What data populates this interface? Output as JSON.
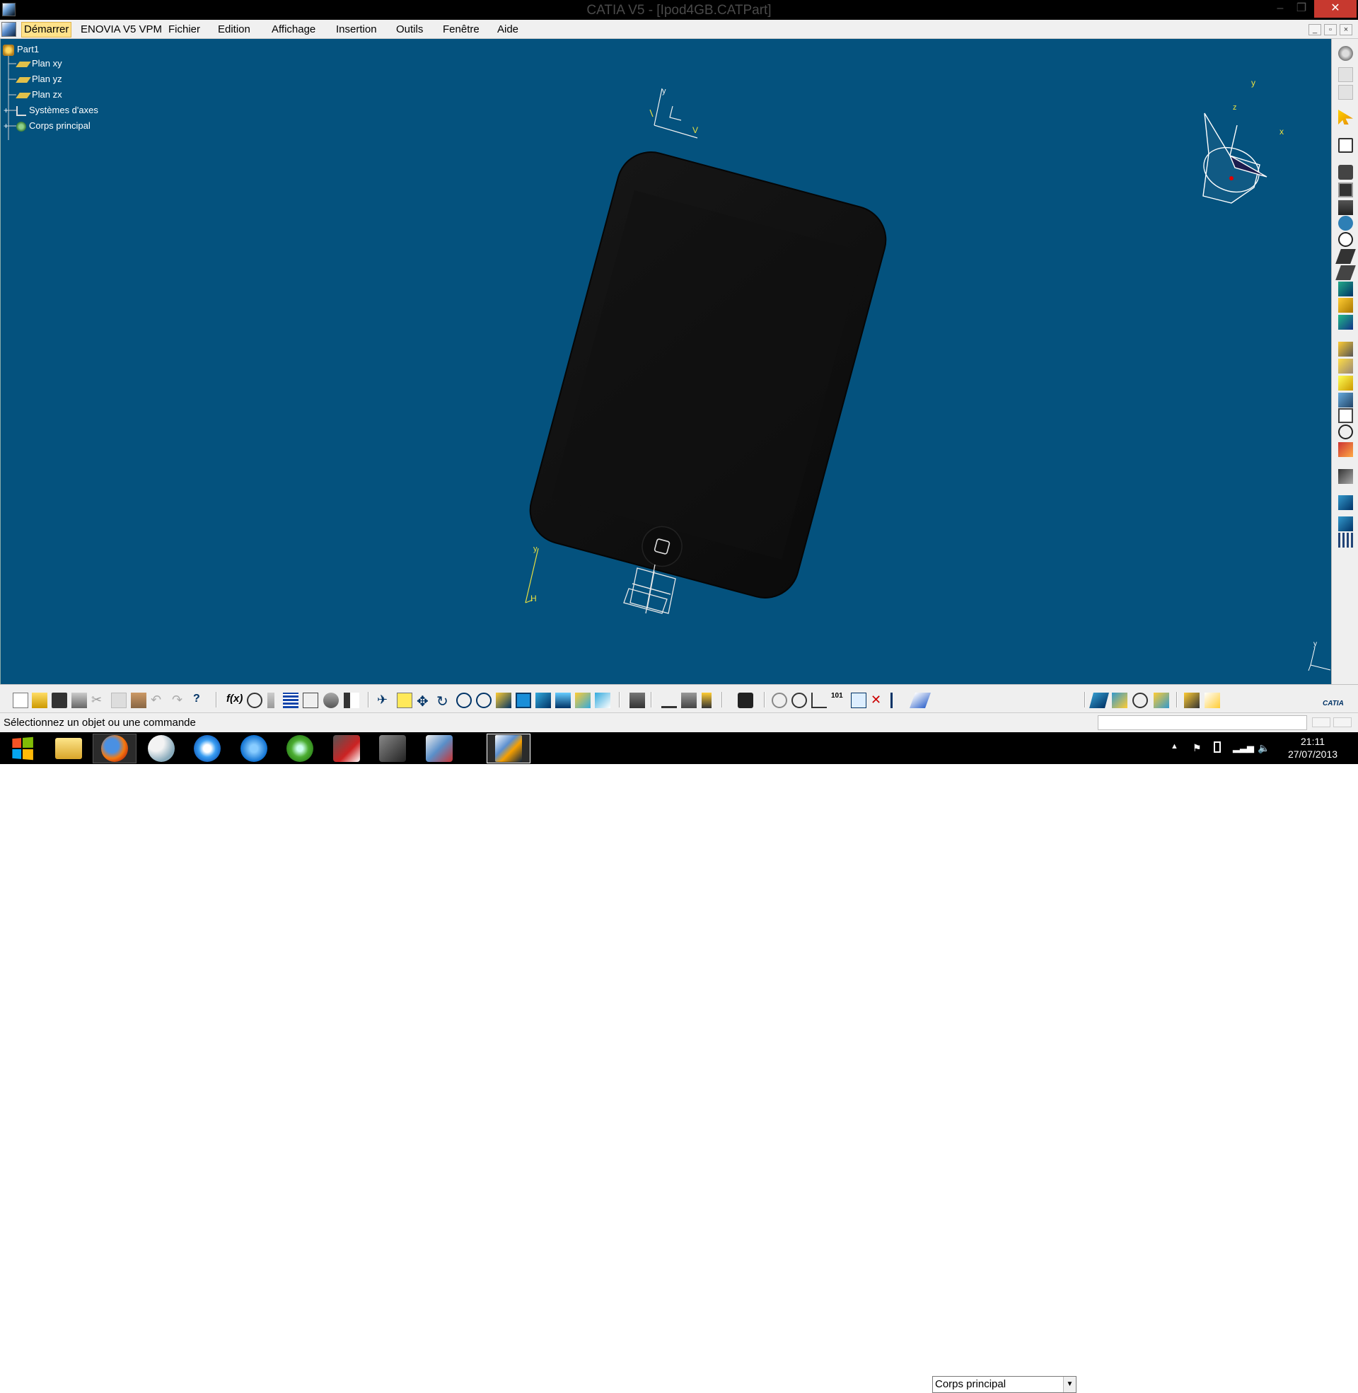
{
  "window": {
    "title": "CATIA V5 - [Ipod4GB.CATPart]",
    "minimize": "–",
    "maximize": "❐",
    "close": "✕"
  },
  "menu": {
    "items": [
      {
        "label": "Démarrer"
      },
      {
        "label": "ENOVIA V5 VPM"
      },
      {
        "label": "Fichier"
      },
      {
        "label": "Edition"
      },
      {
        "label": "Affichage"
      },
      {
        "label": "Insertion"
      },
      {
        "label": "Outils"
      },
      {
        "label": "Fenêtre"
      },
      {
        "label": "Aide"
      }
    ],
    "active": "Démarrer"
  },
  "tree": {
    "root": "Part1",
    "items": [
      {
        "label": "Plan xy",
        "icon": "plane-icon"
      },
      {
        "label": "Plan yz",
        "icon": "plane-icon"
      },
      {
        "label": "Plan zx",
        "icon": "plane-icon"
      },
      {
        "label": "Systèmes d'axes",
        "icon": "axis-system-icon"
      },
      {
        "label": "Corps principal",
        "icon": "part-body-icon"
      }
    ]
  },
  "viewport": {
    "background": "#04527e",
    "axis_labels": {
      "x": "x",
      "y": "y",
      "z": "z",
      "v": "V",
      "h": "H"
    }
  },
  "toolbar": {
    "current_body": "Corps principal"
  },
  "status": {
    "message": "Sélectionnez un objet ou une commande",
    "command_input": ""
  },
  "taskbar": {
    "apps": [
      "start-icon",
      "file-explorer-icon",
      "firefox-icon",
      "paint-icon",
      "itunes-icon",
      "thunder-icon",
      "utorrent-icon",
      "movie-maker-icon",
      "graphics-app-icon",
      "solidworks-icon",
      "catia-icon"
    ],
    "time": "21:11",
    "date": "27/07/2013"
  },
  "brand": {
    "logo_text": "CATIA"
  }
}
